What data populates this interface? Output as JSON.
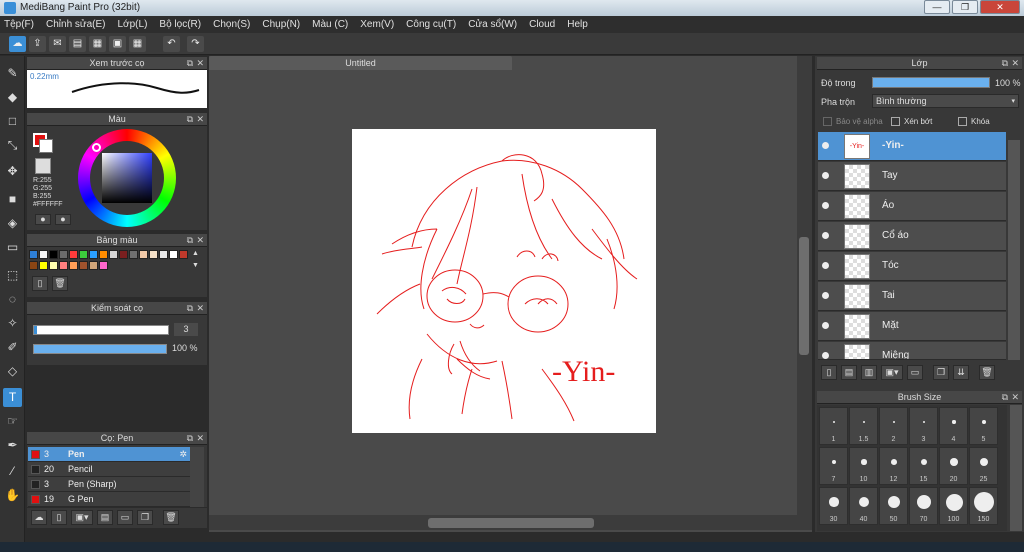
{
  "app": {
    "title": "MediBang Paint Pro (32bit)"
  },
  "menu": [
    "Tệp(F)",
    "Chỉnh sửa(E)",
    "Lớp(L)",
    "Bộ lọc(R)",
    "Chọn(S)",
    "Chụp(N)",
    "Màu (C)",
    "Xem(V)",
    "Công cụ(T)",
    "Cửa sổ(W)",
    "Cloud",
    "Help"
  ],
  "document": {
    "tab": "Untitled",
    "signature": "-Yin-"
  },
  "brush_preview": {
    "title": "Xem trước cọ",
    "size": "0.22mm"
  },
  "color": {
    "title": "Màu",
    "r": "R:255",
    "g": "G:255",
    "b": "B:255",
    "hex": "#FFFFFF",
    "primary": "#e01010",
    "secondary": "#ffffff"
  },
  "palette": {
    "title": "Bảng màu",
    "colors": [
      "#2e7fd6",
      "#f4f4f4",
      "#000000",
      "#6b6b6b",
      "#ff3b3b",
      "#3ccc3c",
      "#2a9fff",
      "#ff8c00",
      "#d4d4d4",
      "#7a1f1f",
      "#707070",
      "#f2c9a8",
      "#f4e0c8",
      "#e8e8e8",
      "#ffffff",
      "#c0392b",
      "#8b4513",
      "#ffff00",
      "#ffffb0",
      "#ff7f7f",
      "#ff9e57",
      "#a0522d",
      "#d2a679",
      "#ff66cc"
    ]
  },
  "brush_control": {
    "title": "Kiểm soát cọ",
    "size": "3",
    "opacity": "100 %",
    "opacity_value": 1.0
  },
  "brush_list": {
    "title": "Cọ: Pen",
    "items": [
      {
        "size": "3",
        "name": "Pen",
        "color": "#e01010"
      },
      {
        "size": "20",
        "name": "Pencil",
        "color": "#222222"
      },
      {
        "size": "3",
        "name": "Pen (Sharp)",
        "color": "#222222"
      },
      {
        "size": "19",
        "name": "G Pen",
        "color": "#e01010"
      }
    ]
  },
  "layers": {
    "title": "Lớp",
    "opacity_label": "Độ trong",
    "opacity": "100 %",
    "opacity_value": 1.0,
    "blend_label": "Pha trộn",
    "blend": "Bình thường",
    "protect_alpha": "Bảo vệ alpha",
    "clipping": "Xén bớt",
    "lock": "Khóa",
    "items": [
      "-Yin-",
      "Tay",
      "Áo",
      "Cổ áo",
      "Tóc",
      "Tai",
      "Mặt",
      "Miệng"
    ]
  },
  "brush_size": {
    "title": "Brush Size",
    "sizes": [
      "1",
      "1.5",
      "2",
      "3",
      "4",
      "5",
      "7",
      "10",
      "12",
      "15",
      "20",
      "25",
      "30",
      "40",
      "50",
      "70",
      "100",
      "150"
    ]
  }
}
